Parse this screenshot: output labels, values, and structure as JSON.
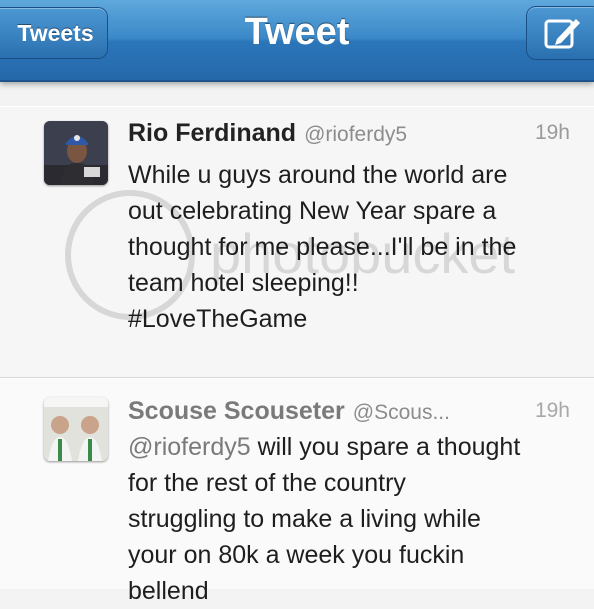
{
  "navbar": {
    "back_label": "Tweets",
    "title": "Tweet",
    "compose_icon": "compose-icon"
  },
  "tweets": [
    {
      "name": "Rio Ferdinand",
      "handle": "@rioferdy5",
      "time": "19h",
      "lines": [
        "While u guys around the world are",
        "out celebrating New Year spare a",
        "thought for me please...I'll be in the",
        "team hotel sleeping!!",
        "#LoveTheGame"
      ]
    },
    {
      "name": "Scouse Scouseter",
      "handle": "@Scous...",
      "time": "19h",
      "mention": "@rioferdy5",
      "lines": [
        " will you spare a thought",
        "for the rest of the country",
        "struggling to make a living while",
        "your on 80k a week you fuckin",
        "bellend"
      ]
    }
  ],
  "watermark_text": "photobucket",
  "colors": {
    "nav_top": "#5fa8dc",
    "nav_bottom": "#2568aa",
    "background": "#f3f3f3"
  }
}
